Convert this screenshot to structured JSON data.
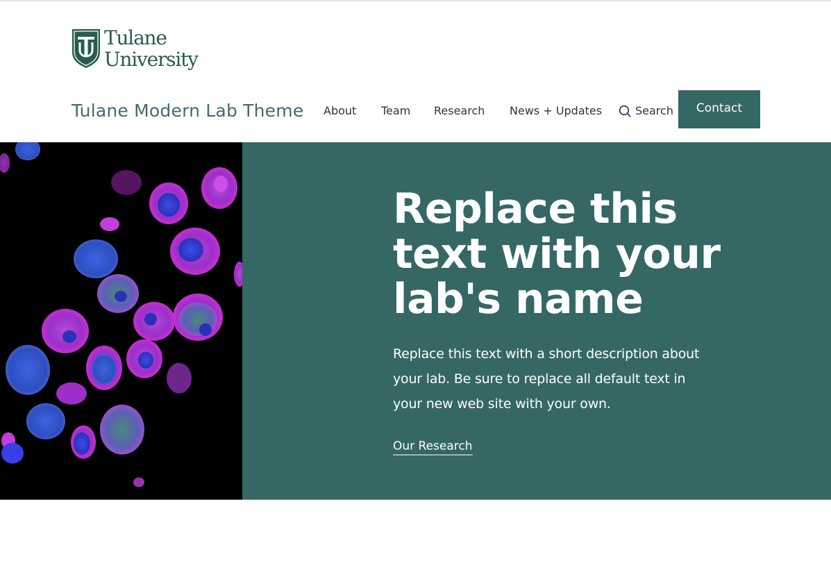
{
  "colors": {
    "brand_green": "#285c4d",
    "hero_teal": "#356765",
    "title_teal": "#3f6d6b",
    "text_white": "#ffffff"
  },
  "logo": {
    "line1": "Tulane",
    "line2": "University",
    "icon": "tulane-shield-icon"
  },
  "header": {
    "site_title": "Tulane Modern Lab Theme",
    "nav": [
      "About",
      "Team",
      "Research",
      "News + Updates"
    ],
    "search_label": "Search",
    "search_icon": "search-icon",
    "contact_label": "Contact"
  },
  "hero": {
    "image_description_icon": "microscopy-cells-image",
    "title": "Replace this text with your lab's name",
    "description": "Replace this text with a short description about your lab. Be sure to replace all default text in your new web site with your own.",
    "link_label": "Our Research"
  }
}
